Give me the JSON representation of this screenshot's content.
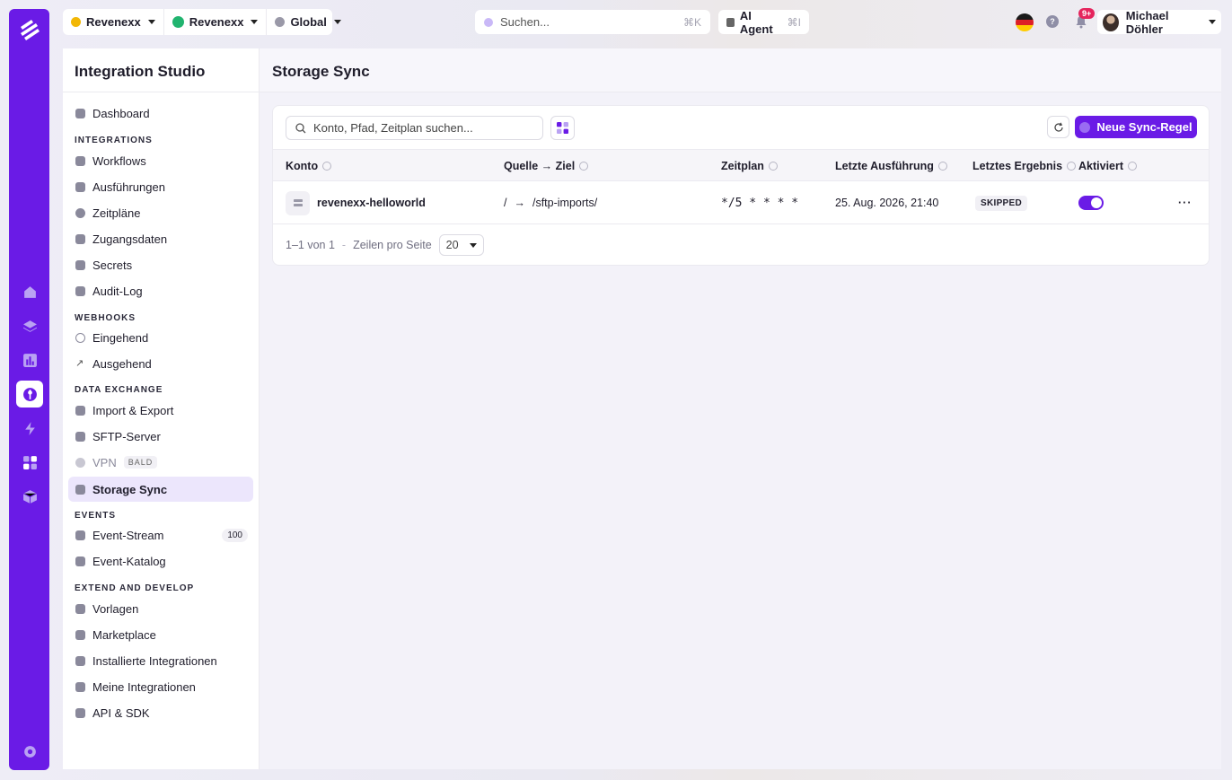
{
  "colors": {
    "accent": "#6a1be6",
    "notif": "#e5255d",
    "green": "#21b46f"
  },
  "topbar": {
    "org": "Revenexx",
    "workspace": "Revenexx",
    "scope": "Global",
    "search_placeholder": "Suchen...",
    "search_kbd": "⌘K",
    "agent_label": "AI Agent",
    "agent_kbd": "⌘I",
    "notif_count": "9+",
    "user_name": "Michael Döhler"
  },
  "sidebar": {
    "title": "Integration Studio",
    "dashboard": "Dashboard",
    "sections": {
      "integrations": "INTEGRATIONS",
      "webhooks": "WEBHOOKS",
      "data_exchange": "DATA EXCHANGE",
      "events": "EVENTS",
      "extend": "EXTEND AND DEVELOP"
    },
    "items": {
      "workflows": "Workflows",
      "ausfuehrungen": "Ausführungen",
      "zeitplaene": "Zeitpläne",
      "zugangsdaten": "Zugangsdaten",
      "secrets": "Secrets",
      "audit_log": "Audit-Log",
      "eingehend": "Eingehend",
      "ausgehend": "Ausgehend",
      "import_export": "Import & Export",
      "sftp_server": "SFTP-Server",
      "vpn": "VPN",
      "vpn_badge": "BALD",
      "storage_sync": "Storage Sync",
      "event_stream": "Event-Stream",
      "event_stream_count": "100",
      "event_katalog": "Event-Katalog",
      "vorlagen": "Vorlagen",
      "marketplace": "Marketplace",
      "installierte": "Installierte Integrationen",
      "meine": "Meine Integrationen",
      "api_sdk": "API & SDK"
    }
  },
  "main": {
    "title": "Storage Sync",
    "search_placeholder": "Konto, Pfad, Zeitplan suchen...",
    "new_button": "Neue Sync-Regel",
    "columns": {
      "konto": "Konto",
      "quelle_ziel": "Quelle → Ziel",
      "zeitplan": "Zeitplan",
      "letzte": "Letzte Ausführung",
      "ergebnis": "Letztes Ergebnis",
      "aktiviert": "Aktiviert"
    },
    "rows": [
      {
        "konto": "revenexx-helloworld",
        "quelle": "/",
        "arrow": "→",
        "ziel": "/sftp-imports/",
        "zeitplan": "*/5 * * * *",
        "letzte": "25. Aug. 2026, 21:40",
        "ergebnis": "SKIPPED",
        "aktiviert": true,
        "more": "···"
      }
    ],
    "footer": {
      "range": "1–1 von 1",
      "sep": "-",
      "per_page_label": "Zeilen pro Seite",
      "per_page_value": "20"
    }
  }
}
